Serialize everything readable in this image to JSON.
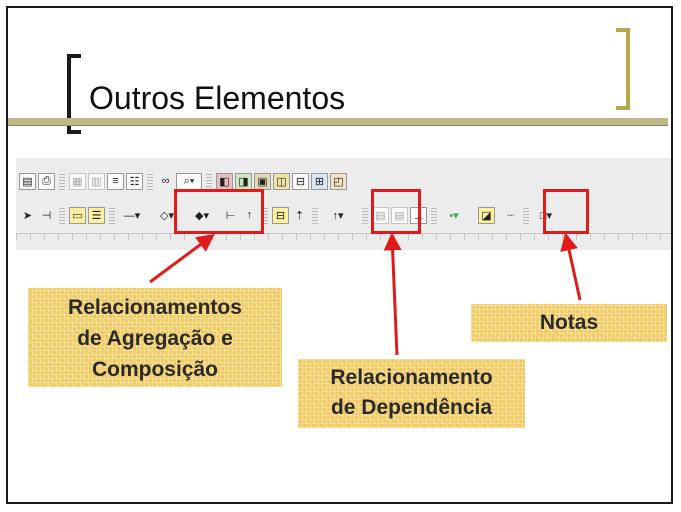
{
  "slide": {
    "title": "Outros Elementos"
  },
  "toolbar": {
    "row1_icons": [
      "page-icon",
      "print-icon",
      "grid-icon",
      "trash-icon",
      "align-icon",
      "list-icon",
      "binoculars-icon",
      "zoom-icon",
      "diagram-red-icon",
      "diagram-green-icon",
      "diagram-class-icon",
      "diagram-seq-icon",
      "diagram-state-icon",
      "diagram-comp-icon",
      "diagram-deploy-icon"
    ],
    "row2_icons": [
      "select-arrow-icon",
      "anchor-icon",
      "class-box-icon",
      "interface-box-icon",
      "association-line-icon",
      "aggregation-icon",
      "composition-icon",
      "generalization-icon",
      "up-arrow-icon",
      "package-icon",
      "realization-icon",
      "dependency-icon",
      "partition-icon",
      "partition2-icon",
      "node-icon",
      "dot-icon",
      "note-icon",
      "note-link-icon",
      "rectangle-icon"
    ]
  },
  "callouts": {
    "aggregation": {
      "line1": "Relacionamentos",
      "line2": "de Agregação e",
      "line3": "Composição"
    },
    "dependency": {
      "line1": "Relacionamento",
      "line2": "de Dependência"
    },
    "notes": {
      "label": "Notas"
    }
  },
  "colors": {
    "highlight": "#e01b1b",
    "callout_fill": "#f2cf6a",
    "title_band": "#bfb98a",
    "bracket_accent": "#b8a64a"
  }
}
